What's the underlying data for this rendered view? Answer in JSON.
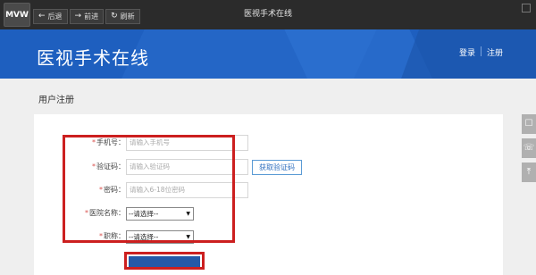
{
  "app": {
    "logo": "MVW",
    "window_title": "医视手术在线"
  },
  "nav": {
    "back": "后退",
    "forward": "前进",
    "refresh": "刷新"
  },
  "header": {
    "site_title": "医视手术在线",
    "login": "登录",
    "register": "注册"
  },
  "page": {
    "title": "用户注册"
  },
  "form": {
    "phone": {
      "label": "手机号：",
      "placeholder": "请输入手机号"
    },
    "code": {
      "label": "验证码：",
      "placeholder": "请输入验证码",
      "button": "获取验证码"
    },
    "password": {
      "label": "密码：",
      "placeholder": "请输入6-18位密码"
    },
    "hospital": {
      "label": "医院名称：",
      "value": "--请选择--"
    },
    "title": {
      "label": "职称：",
      "value": "--请选择--"
    }
  },
  "colors": {
    "banner": "#1f5cb0",
    "highlight": "#cc1f1f",
    "required": "#d9534f"
  }
}
